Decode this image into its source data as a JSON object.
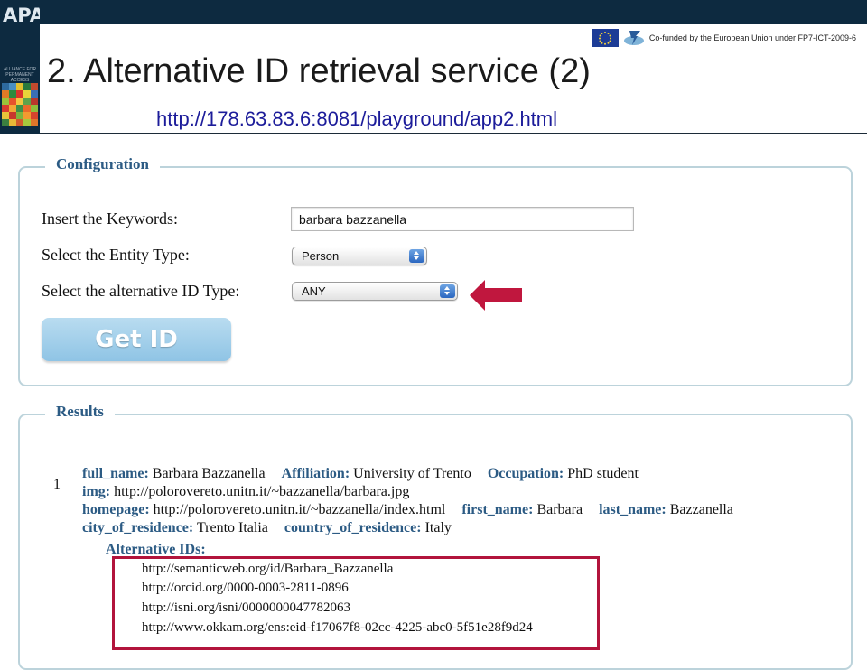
{
  "logo": {
    "letters": "APA",
    "tagline": "ALLIANCE FOR PERMANENT ACCESS"
  },
  "funding": {
    "text": "Co-funded by the European Union under FP7-ICT-2009-6"
  },
  "slide": {
    "title": "2. Alternative ID retrieval service (2)",
    "url": "http://178.63.83.6:8081/playground/app2.html"
  },
  "configuration": {
    "legend": "Configuration",
    "keywords_label": "Insert the Keywords:",
    "keywords_value": "barbara bazzanella",
    "entity_type_label": "Select the Entity Type:",
    "entity_type_value": "Person",
    "alt_id_type_label": "Select the alternative ID Type:",
    "alt_id_type_value": "ANY",
    "get_id_label": "Get ID"
  },
  "results": {
    "legend": "Results",
    "index": "1",
    "fields": {
      "full_name_key": "full_name:",
      "full_name": "Barbara Bazzanella",
      "affiliation_key": "Affiliation:",
      "affiliation": "University of Trento",
      "occupation_key": "Occupation:",
      "occupation": "PhD student",
      "img_key": "img:",
      "img": "http://polorovereto.unitn.it/~bazzanella/barbara.jpg",
      "homepage_key": "homepage:",
      "homepage": "http://polorovereto.unitn.it/~bazzanella/index.html",
      "first_name_key": "first_name:",
      "first_name": "Barbara",
      "last_name_key": "last_name:",
      "last_name": "Bazzanella",
      "city_key": "city_of_residence:",
      "city": "Trento Italia",
      "country_key": "country_of_residence:",
      "country": "Italy"
    },
    "alternative_ids_title": "Alternative IDs:",
    "alternative_ids": [
      "http://semanticweb.org/id/Barbara_Bazzanella",
      "http://orcid.org/0000-0003-2811-0896",
      "http://isni.org/isni/0000000047782063",
      "http://www.okkam.org/ens:eid-f17067f8-02cc-4225-abc0-5f51e28f9d24"
    ]
  },
  "colors": {
    "header_bg": "#0d2a40",
    "panel_border": "#bcd3db",
    "legend_text": "#2c5b84",
    "button_bg": "#9ccbe8",
    "highlight": "#b2143c",
    "url_text": "#1c1c9a"
  },
  "icons": [
    "eu-flag-icon",
    "fp7-logo-icon",
    "red-arrow-icon",
    "select-stepper-icon"
  ]
}
